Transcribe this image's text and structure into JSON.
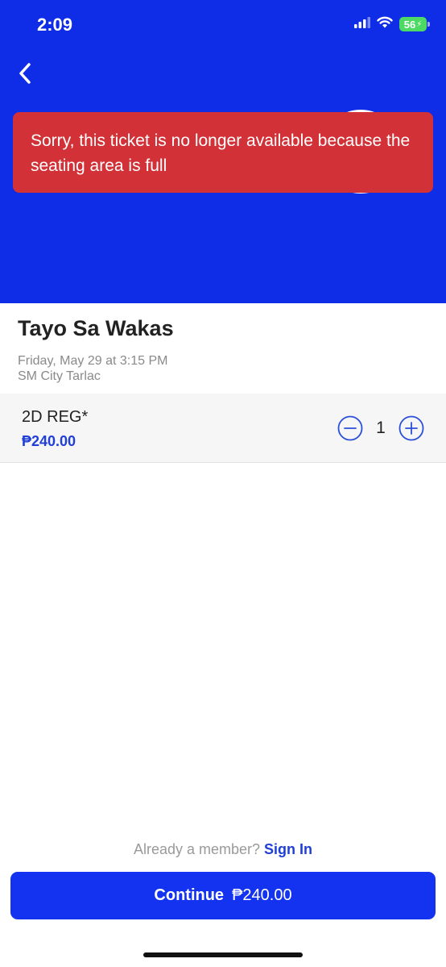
{
  "status_bar": {
    "time": "2:09",
    "battery_level": "56",
    "icons": [
      "signal-icon",
      "wifi-icon",
      "battery-icon"
    ]
  },
  "header": {
    "background_color": "#0f2ce6",
    "back_icon": "chevron-left-icon"
  },
  "toast": {
    "message": "Sorry, this ticket is no longer available because the seating area is full",
    "background_color": "#d23237"
  },
  "movie": {
    "title": "Tayo Sa Wakas",
    "showtime": "Friday, May 29 at 3:15 PM",
    "cinema": "SM City Tarlac"
  },
  "ticket": {
    "name": "2D REG*",
    "price": "₱240.00",
    "quantity": "1",
    "decrement_icon": "minus-circle-icon",
    "increment_icon": "plus-circle-icon"
  },
  "footer": {
    "member_prompt": "Already a member?",
    "sign_in_label": "Sign In",
    "continue_label": "Continue",
    "continue_amount": "₱240.00",
    "accent_color": "#1433f0"
  }
}
